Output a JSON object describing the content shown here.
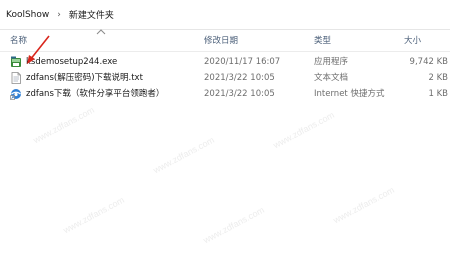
{
  "breadcrumb": {
    "items": [
      "KoolShow",
      "新建文件夹"
    ],
    "separator": "›"
  },
  "columns": {
    "name": "名称",
    "date": "修改日期",
    "type": "类型",
    "size": "大小"
  },
  "files": [
    {
      "name": "ksdemosetup244.exe",
      "date": "2020/11/17 16:07",
      "type": "应用程序",
      "size": "9,742 KB",
      "icon": "exe-installer-icon"
    },
    {
      "name": "zdfans(解压密码)下载说明.txt",
      "date": "2021/3/22 10:05",
      "type": "文本文档",
      "size": "2 KB",
      "icon": "text-document-icon"
    },
    {
      "name": "zdfans下载（软件分享平台领跑者）",
      "date": "2021/3/22 10:05",
      "type": "Internet 快捷方式",
      "size": "1 KB",
      "icon": "internet-shortcut-icon"
    }
  ],
  "colors": {
    "header_text": "#4c607a",
    "annotation_arrow": "#d9261c",
    "meta_text": "#6d6d6d"
  },
  "watermark_text": "www.zdfans.com"
}
